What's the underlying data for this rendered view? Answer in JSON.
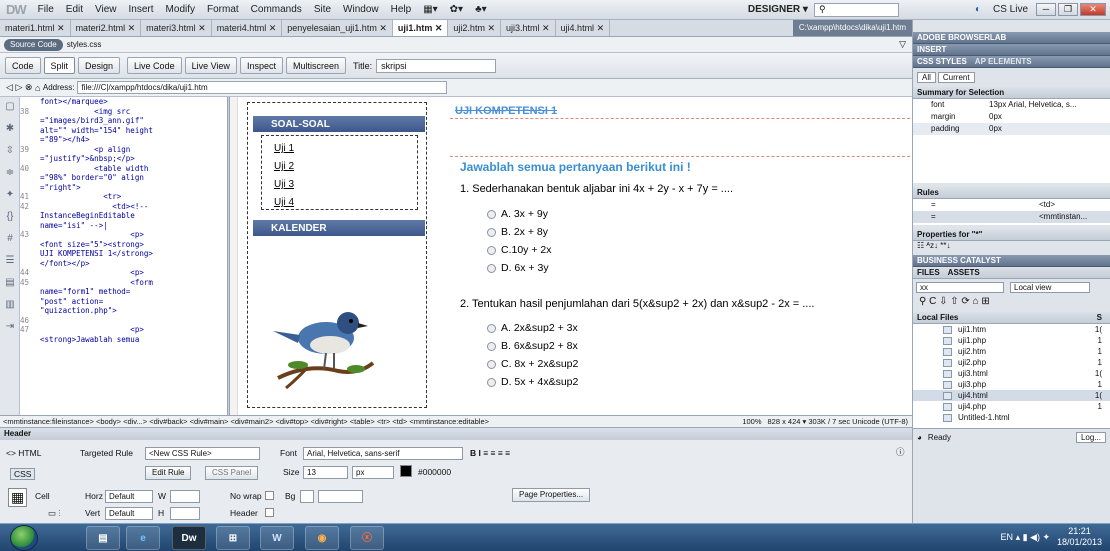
{
  "menubar": {
    "logo": "DW",
    "items": [
      "File",
      "Edit",
      "View",
      "Insert",
      "Modify",
      "Format",
      "Commands",
      "Site",
      "Window",
      "Help"
    ],
    "workspace": "DESIGNER ▾",
    "cslive": "CS Live"
  },
  "tabs": [
    "materi1.html",
    "materi2.html",
    "materi3.html",
    "materi4.html",
    "penyelesaian_uji1.htm",
    "uji1.htm",
    "uji2.htm",
    "uji3.html",
    "uji4.html"
  ],
  "active_tab": "uji1.htm",
  "file_path": "C:\\xampp\\htdocs\\dika\\uji1.htm",
  "related": {
    "source": "Source Code",
    "css": "styles.css"
  },
  "doctoolbar": {
    "code": "Code",
    "split": "Split",
    "design": "Design",
    "livecode": "Live Code",
    "liveview": "Live View",
    "inspect": "Inspect",
    "multiscreen": "Multiscreen",
    "title_label": "Title:",
    "title_value": "skripsi"
  },
  "address": {
    "label": "Address:",
    "value": "file:///C|/xampp/htdocs/dika/uji1.htm"
  },
  "code_lines": [
    {
      "n": "",
      "t": "font></marquee>"
    },
    {
      "n": "38",
      "t": "            <img src"
    },
    {
      "n": "",
      "t": "=\"images/bird3_ann.gif\""
    },
    {
      "n": "",
      "t": "alt=\"\" width=\"154\" height"
    },
    {
      "n": "",
      "t": "=\"89\"></h4>"
    },
    {
      "n": "39",
      "t": "            <p align"
    },
    {
      "n": "",
      "t": "=\"justify\">&nbsp;</p>"
    },
    {
      "n": "40",
      "t": "            <table width"
    },
    {
      "n": "",
      "t": "=\"98%\" border=\"0\" align"
    },
    {
      "n": "",
      "t": "=\"right\">"
    },
    {
      "n": "41",
      "t": "              <tr>"
    },
    {
      "n": "42",
      "t": "                <td><!--"
    },
    {
      "n": "",
      "t": "InstanceBeginEditable"
    },
    {
      "n": "",
      "t": "name=\"isi\" -->|"
    },
    {
      "n": "43",
      "t": "                    <p>"
    },
    {
      "n": "",
      "t": "<font size=\"5\"><strong>"
    },
    {
      "n": "",
      "t": "UJI KOMPETENSI 1</strong>"
    },
    {
      "n": "",
      "t": "</font></p>"
    },
    {
      "n": "44",
      "t": "                    <p>"
    },
    {
      "n": "45",
      "t": "                    <form"
    },
    {
      "n": "",
      "t": "name=\"form1\" method="
    },
    {
      "n": "",
      "t": "\"post\" action="
    },
    {
      "n": "",
      "t": "\"quizaction.php\">"
    },
    {
      "n": "46",
      "t": ""
    },
    {
      "n": "47",
      "t": "                    <p>"
    },
    {
      "n": "",
      "t": "<strong>Jawablah semua"
    }
  ],
  "sidebar": {
    "soal_title": "SOAL-SOAL",
    "links": [
      "Uji 1",
      "Uji 2",
      "Uji 3",
      "Uji 4"
    ],
    "kalender_title": "KALENDER"
  },
  "main": {
    "title": "UJI KOMPETENSI 1",
    "instruction": "Jawablah semua pertanyaan berikut ini !",
    "q1": "1. Sederhanakan bentuk aljabar ini 4x + 2y - x + 7y = ....",
    "q1_opts": [
      "A. 3x + 9y",
      "B. 2x + 8y",
      "C.10y + 2x",
      "D. 6x + 3y"
    ],
    "q2": "2. Tentukan hasil penjumlahan dari 5(x&sup2 + 2x) dan x&sup2 - 2x = ....",
    "q2_opts": [
      "A. 2x&sup2 + 3x",
      "B. 6x&sup2 + 8x",
      "C. 8x + 2x&sup2",
      "D. 5x + 4x&sup2"
    ]
  },
  "statusbar": {
    "tags": "<mmtinstance:fileinstance> <body> <div...> <div#back> <div#main> <div#main2> <div#top> <div#right> <table> <tr> <td> <mmtinstance:editable>",
    "zoom": "100%",
    "size": "828 x 424 ▾ 303K / 7 sec Unicode (UTF-8)"
  },
  "properties": {
    "header": "Header",
    "html": "<> HTML",
    "css": "CSS",
    "targeted_label": "Targeted Rule",
    "targeted_value": "<New CSS Rule>",
    "font_label": "Font",
    "font_value": "Arial, Helvetica, sans-serif",
    "edit_rule": "Edit Rule",
    "css_panel": "CSS Panel",
    "size_label": "Size",
    "size_value": "13",
    "unit": "px",
    "color": "#000000",
    "cell": "Cell",
    "horz": "Horz",
    "horz_value": "Default",
    "vert": "Vert",
    "vert_value": "Default",
    "w": "W",
    "h": "H",
    "nowrap": "No wrap",
    "bg": "Bg",
    "page_props": "Page Properties..."
  },
  "right": {
    "browserlab": "ADOBE BROWSERLAB",
    "insert": "INSERT",
    "css_styles": "CSS STYLES",
    "ap": "AP ELEMENTS",
    "all": "All",
    "current": "Current",
    "summary": "Summary for Selection",
    "props": [
      [
        "font",
        "13px Arial, Helvetica, s..."
      ],
      [
        "margin",
        "0px"
      ],
      [
        "padding",
        "0px"
      ]
    ],
    "rules": "Rules",
    "rule_rows": [
      [
        "=",
        "<td>"
      ],
      [
        "=",
        "<mmtinstan..."
      ]
    ],
    "props_for": "Properties for \"*\"",
    "business": "BUSINESS CATALYST",
    "files": "FILES",
    "assets": "ASSETS",
    "site": "xx",
    "view": "Local view",
    "local_files": "Local Files",
    "size_col": "S",
    "files_list": [
      "uji1.htm",
      "uji1.php",
      "uji2.htm",
      "uji2.php",
      "uji3.html",
      "uji3.php",
      "uji4.html",
      "uji4.php",
      "Untitled-1.html"
    ],
    "files_sizes": [
      "1(",
      "1",
      "1",
      "1",
      "1(",
      "1",
      "1(",
      "1",
      ""
    ],
    "ready": "Ready",
    "log": "Log..."
  },
  "taskbar": {
    "time": "21:21",
    "date": "18/01/2013",
    "lang": "EN"
  }
}
